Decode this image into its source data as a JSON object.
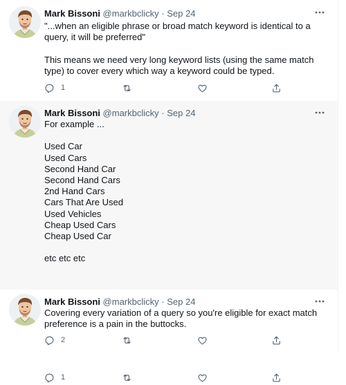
{
  "tweets": [
    {
      "name": "Mark Bissoni",
      "handle": "@markbclicky",
      "separator": "·",
      "date": "Sep 24",
      "text": "\"...when an eligible phrase or broad match keyword is identical to a query, it will be preferred\"\n\nThis means we need very long keyword lists (using the same match type) to cover every which way a keyword could be typed.",
      "reply_count": "1"
    },
    {
      "name": "Mark Bissoni",
      "handle": "@markbclicky",
      "separator": "·",
      "date": "Sep 24",
      "text": "For example ...\n\nUsed Car\nUsed Cars\nSecond Hand Car\nSecond Hand Cars\n2nd Hand Cars\nCars That Are Used\nUsed Vehicles\nCheap Used Cars\nCheap Used Car\n\netc etc etc",
      "reply_count": "1"
    },
    {
      "name": "Mark Bissoni",
      "handle": "@markbclicky",
      "separator": "·",
      "date": "Sep 24",
      "text": "Covering every variation of a query so you're eligible for exact match preference is a pain in the buttocks.",
      "reply_count": "2"
    }
  ],
  "icons": {
    "more": "more-options-icon",
    "reply": "reply-icon",
    "retweet": "retweet-icon",
    "like": "like-heart-icon",
    "share": "share-icon"
  },
  "colors": {
    "text": "#0f1419",
    "secondary": "#536471",
    "thread_line": "#cfd9de",
    "highlight_bg": "#f7f7f7"
  }
}
